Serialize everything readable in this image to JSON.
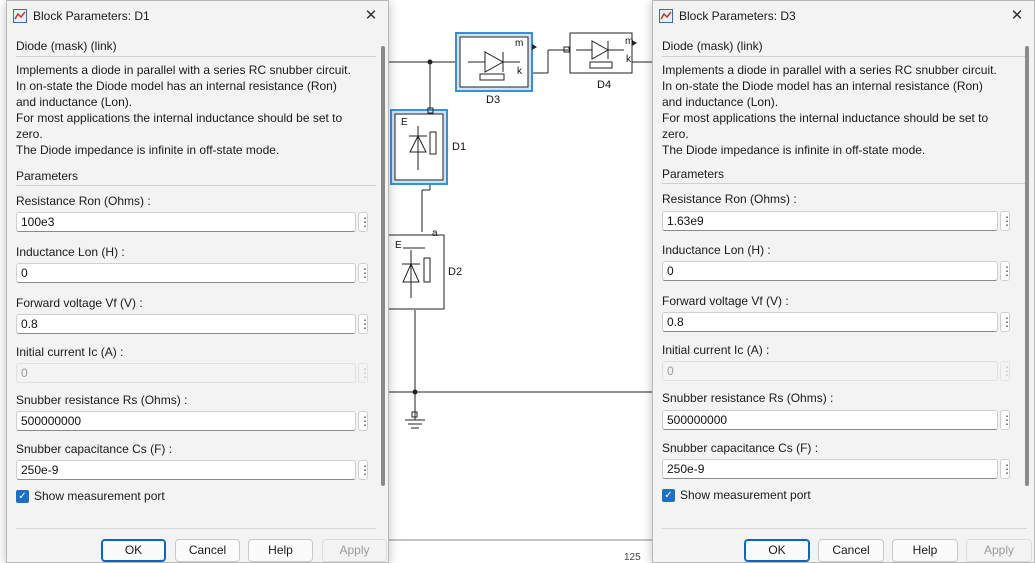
{
  "canvas": {
    "blocks": [
      {
        "label": "D3"
      },
      {
        "label": "D4"
      },
      {
        "label": "D1"
      },
      {
        "label": "D2"
      }
    ],
    "port_labels": {
      "m": "m",
      "k": "k",
      "a": "a",
      "E": "E"
    },
    "zoom": "125"
  },
  "dialogs": [
    {
      "title": "Block Parameters: D1",
      "group_title": "Diode (mask) (link)",
      "description": [
        "Implements a diode in parallel with a series RC snubber circuit.",
        "In on-state the Diode model has an internal resistance (Ron)",
        "and inductance (Lon).",
        "For most applications the internal inductance should be set to",
        "zero.",
        "The Diode impedance is infinite in off-state mode."
      ],
      "params_title": "Parameters",
      "params": [
        {
          "label": "Resistance Ron (Ohms) :",
          "value": "100e3",
          "enabled": true
        },
        {
          "label": "Inductance Lon (H) :",
          "value": "0",
          "enabled": true
        },
        {
          "label": "Forward voltage Vf (V) :",
          "value": "0.8",
          "enabled": true
        },
        {
          "label": "Initial current Ic (A) :",
          "value": "0",
          "enabled": false
        },
        {
          "label": "Snubber resistance Rs (Ohms) :",
          "value": "500000000",
          "enabled": true
        },
        {
          "label": "Snubber capacitance Cs (F) :",
          "value": "250e-9",
          "enabled": true
        }
      ],
      "checkbox": {
        "label": "Show measurement port",
        "checked": true
      },
      "buttons": {
        "ok": "OK",
        "cancel": "Cancel",
        "help": "Help",
        "apply": "Apply"
      }
    },
    {
      "title": "Block Parameters: D3",
      "group_title": "Diode (mask) (link)",
      "description": [
        "Implements a diode in parallel with a series RC snubber circuit.",
        "In on-state the Diode model has an internal resistance (Ron)",
        "and inductance (Lon).",
        "For most applications the internal inductance should be set to",
        "zero.",
        "The Diode impedance is infinite in off-state mode."
      ],
      "params_title": "Parameters",
      "params": [
        {
          "label": "Resistance Ron (Ohms) :",
          "value": "1.63e9",
          "enabled": true
        },
        {
          "label": "Inductance Lon (H) :",
          "value": "0",
          "enabled": true
        },
        {
          "label": "Forward voltage Vf (V) :",
          "value": "0.8",
          "enabled": true
        },
        {
          "label": "Initial current Ic (A) :",
          "value": "0",
          "enabled": false
        },
        {
          "label": "Snubber resistance Rs (Ohms) :",
          "value": "500000000",
          "enabled": true
        },
        {
          "label": "Snubber capacitance Cs (F) :",
          "value": "250e-9",
          "enabled": true
        }
      ],
      "checkbox": {
        "label": "Show measurement port",
        "checked": true
      },
      "buttons": {
        "ok": "OK",
        "cancel": "Cancel",
        "help": "Help",
        "apply": "Apply"
      }
    }
  ],
  "icons": {
    "app": "simulink-block-icon",
    "close": "close-icon",
    "menu": "vertical-ellipsis-icon",
    "check": "checkmark-icon"
  },
  "colors": {
    "selection_blue": "#3b8fd9",
    "checkbox_blue": "#1f6fc9",
    "ok_border": "#0a64c4"
  }
}
